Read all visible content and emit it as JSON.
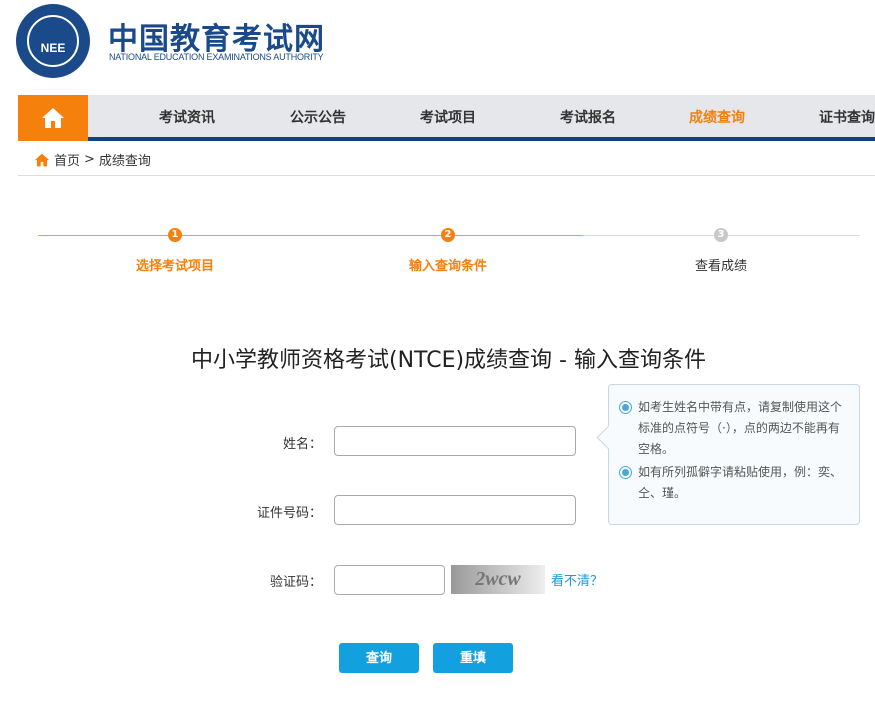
{
  "header": {
    "logo_text": "NEE",
    "site_name_cn": "中国教育考试网",
    "site_name_en": "NATIONAL EDUCATION EXAMINATIONS AUTHORITY"
  },
  "nav": {
    "home_icon": "home-icon",
    "items": [
      {
        "label": "考试资讯"
      },
      {
        "label": "公示公告"
      },
      {
        "label": "考试项目"
      },
      {
        "label": "考试报名"
      },
      {
        "label": "成绩查询",
        "active": true
      },
      {
        "label": "证书查询"
      }
    ]
  },
  "breadcrumb": {
    "home": "首页",
    "separator": ">",
    "current": "成绩查询"
  },
  "steps": [
    {
      "num": "1",
      "label": "选择考试项目",
      "state": "done"
    },
    {
      "num": "2",
      "label": "输入查询条件",
      "state": "current"
    },
    {
      "num": "3",
      "label": "查看成绩",
      "state": "pending"
    }
  ],
  "colors": {
    "accent": "#f5800b",
    "brand": "#1a4a8a",
    "button": "#13a0de"
  },
  "title": "中小学教师资格考试(NTCE)成绩查询 - 输入查询条件",
  "form": {
    "name_label": "姓名：",
    "name_value": "",
    "id_label": "证件号码：",
    "id_value": "",
    "captcha_label": "验证码：",
    "captcha_value": "",
    "captcha_text": "2wcw",
    "refresh_link": "看不清？",
    "submit": "查询",
    "reset": "重填"
  },
  "tip": {
    "items": [
      "如考生姓名中带有点，请复制使用这个标准的点符号（·），点的两边不能再有空格。",
      "如有所列孤僻字请粘贴使用，例：奕、仝、瑾。"
    ]
  }
}
